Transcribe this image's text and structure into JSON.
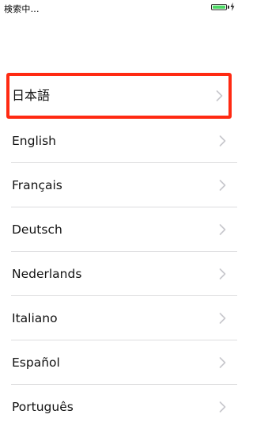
{
  "status_bar": {
    "carrier_text": "検索中...",
    "battery_level": 1.0,
    "battery_color": "#4cd964",
    "charging_icon": "bolt-icon"
  },
  "languages": {
    "selected_index": 0,
    "highlight_color": "#ff2a12",
    "chevron_icon": "chevron-right-icon",
    "items": [
      {
        "label": "日本語"
      },
      {
        "label": "English"
      },
      {
        "label": "Français"
      },
      {
        "label": "Deutsch"
      },
      {
        "label": "Nederlands"
      },
      {
        "label": "Italiano"
      },
      {
        "label": "Español"
      },
      {
        "label": "Português"
      }
    ]
  }
}
